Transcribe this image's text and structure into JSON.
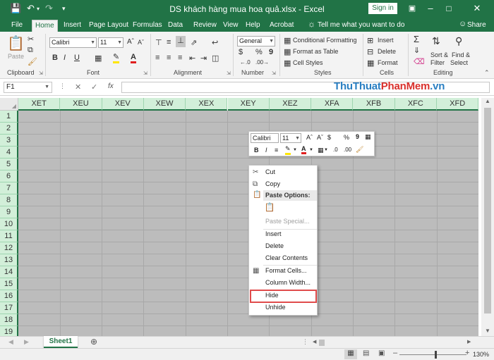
{
  "titlebar": {
    "title": "DS khách hàng mua hoa quả.xlsx  -  Excel",
    "signin": "Sign in",
    "save_icon": "save-icon",
    "undo_icon": "undo-icon",
    "redo_icon": "redo-icon"
  },
  "tabs": [
    "File",
    "Home",
    "Insert",
    "Page Layout",
    "Formulas",
    "Data",
    "Review",
    "View",
    "Help",
    "Acrobat"
  ],
  "active_tab": "Home",
  "tell_me": "Tell me what you want to do",
  "share": "Share",
  "ribbon": {
    "clipboard": {
      "label": "Clipboard",
      "paste": "Paste"
    },
    "font": {
      "label": "Font",
      "name": "Calibri",
      "size": "11",
      "bold": "B",
      "italic": "I",
      "underline": "U"
    },
    "alignment": {
      "label": "Alignment"
    },
    "number": {
      "label": "Number",
      "format": "General",
      "currency": "$",
      "percent": "%",
      "comma": "9"
    },
    "styles": {
      "label": "Styles",
      "conditional": "Conditional Formatting",
      "format_table": "Format as Table",
      "cell_styles": "Cell Styles"
    },
    "cells": {
      "label": "Cells",
      "insert": "Insert",
      "delete": "Delete",
      "format": "Format"
    },
    "editing": {
      "label": "Editing",
      "sort": "Sort &",
      "filter": "Filter",
      "find": "Find &",
      "select": "Select"
    }
  },
  "formula_bar": {
    "name_box": "F1",
    "fx": "fx"
  },
  "watermark": {
    "part1": "ThuThuat",
    "part2": "PhanMem",
    "part3": ".vn"
  },
  "columns": [
    "XET",
    "XEU",
    "XEV",
    "XEW",
    "XEX",
    "XEY",
    "XEZ",
    "XFA",
    "XFB",
    "XFC",
    "XFD"
  ],
  "rows": [
    "1",
    "2",
    "3",
    "4",
    "5",
    "6",
    "7",
    "8",
    "9",
    "10",
    "11",
    "12",
    "13",
    "14",
    "15",
    "16",
    "17",
    "18",
    "19"
  ],
  "mini_toolbar": {
    "font": "Calibri",
    "size": "11",
    "bold": "B",
    "italic": "I",
    "currency": "$",
    "percent": "%",
    "comma": "9"
  },
  "context_menu": {
    "cut": "Cut",
    "copy": "Copy",
    "paste_options": "Paste Options:",
    "paste_special": "Paste Special...",
    "insert": "Insert",
    "delete": "Delete",
    "clear_contents": "Clear Contents",
    "format_cells": "Format Cells...",
    "column_width": "Column Width...",
    "hide": "Hide",
    "unhide": "Unhide"
  },
  "sheet_tab": "Sheet1",
  "status": {
    "zoom": "130%"
  },
  "colors": {
    "excel_green": "#217346",
    "header_green": "#d2efd9",
    "selection_gray": "#bcbcbc",
    "highlight_red": "#e04b4b"
  }
}
